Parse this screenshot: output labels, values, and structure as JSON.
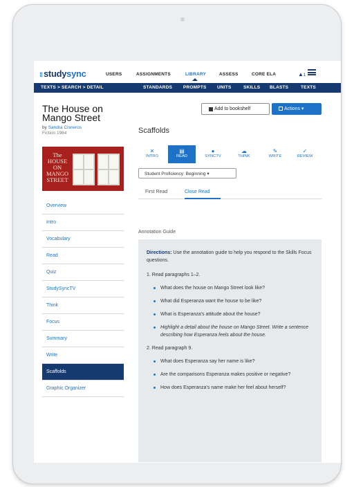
{
  "app": {
    "logo_prefix": "study",
    "logo_suffix": "sync"
  },
  "topnav": {
    "items": [
      "USERS",
      "ASSIGNMENTS",
      "LIBRARY",
      "ASSESS",
      "CORE ELA"
    ],
    "active": "LIBRARY",
    "notification_count": "1"
  },
  "breadcrumb": "TEXTS  >  SEARCH  >  DETAIL",
  "subnav": [
    "STANDARDS",
    "PROMPTS",
    "UNITS",
    "SKILLS",
    "BLASTS",
    "TEXTS"
  ],
  "book": {
    "title": "The House on Mango Street",
    "by_prefix": "by",
    "author": "Sandra Cisneros",
    "genre_year": "Fiction 1984",
    "cover_text": "The HOUSE ON MANGO STREET"
  },
  "sidebar": {
    "items": [
      "Overview",
      "Intro",
      "Vocabulary",
      "Read",
      "Quiz",
      "StudySyncTV",
      "Think",
      "Focus",
      "Summary",
      "Write",
      "Scaffolds",
      "Graphic Organizer"
    ],
    "active_index": 10
  },
  "buttons": {
    "bookshelf": "Add to bookshelf",
    "actions": "Actions"
  },
  "section_title": "Scaffolds",
  "tabs": [
    {
      "label": "INTRO",
      "icon": "expand-icon",
      "glyph": "✕"
    },
    {
      "label": "READ",
      "icon": "book-icon",
      "glyph": "▤"
    },
    {
      "label": "SYNCTV",
      "icon": "play-icon",
      "glyph": "●"
    },
    {
      "label": "THINK",
      "icon": "cloud-icon",
      "glyph": "☁"
    },
    {
      "label": "WRITE",
      "icon": "pencil-icon",
      "glyph": "✎"
    },
    {
      "label": "REVIEW",
      "icon": "check-icon",
      "glyph": "✓"
    }
  ],
  "active_tab": "READ",
  "proficiency": "Student Proficiency: Beginning",
  "subtabs": [
    "First Read",
    "Close Read"
  ],
  "active_subtab": "Close Read",
  "annotation_label": "Annotation Guide",
  "guide": {
    "directions_label": "Directions:",
    "directions_text": " Use the annotation guide to help you respond to the Skills Focus questions.",
    "section1": "1. Read paragraphs 1–2.",
    "section1_items": [
      "What does the house on Mango Street look like?",
      "What did Esperanza want the house to be like?",
      "What is Esperanza's attitude about the house?",
      "Highlight a detail about the house on Mango Street. Write a sentence describing how Esperanza feels about the house."
    ],
    "section2": "2. Read paragraph 9.",
    "section2_items": [
      "What does Esperanza say her name is like?",
      "Are the comparisons Esperanza makes positive or negative?",
      "How does Esperanza's name make her feel about herself?"
    ]
  }
}
